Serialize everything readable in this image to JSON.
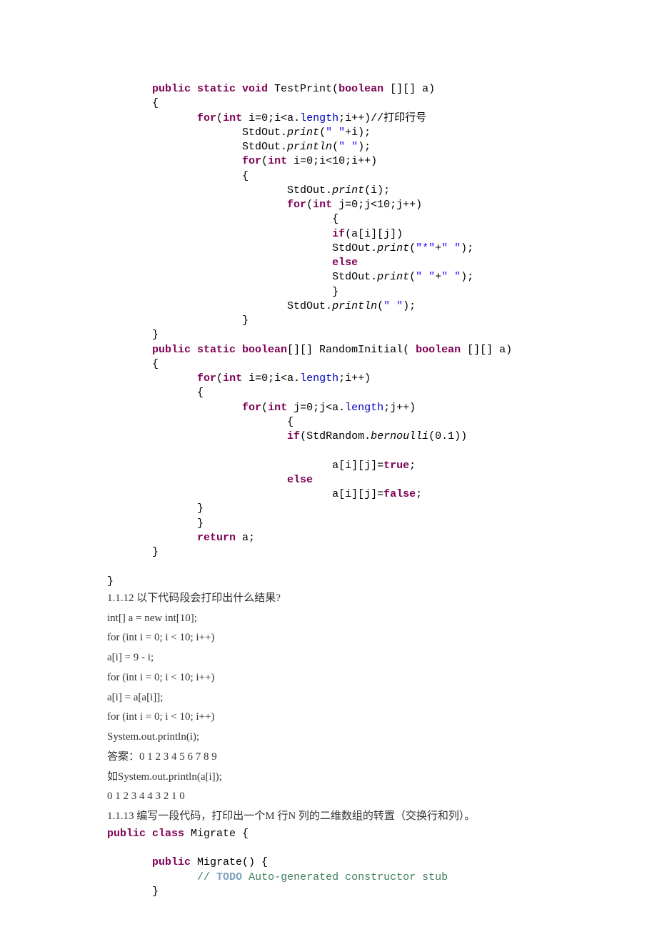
{
  "code1": {
    "l1a": "public static void",
    "l1b": " TestPrint(",
    "l1c": "boolean",
    "l1d": " [][] a)",
    "l2": "{",
    "l3a": "for",
    "l3b": "(",
    "l3c": "int",
    "l3d": " i=0;i<a.",
    "l3e": "length",
    "l3f": ";i++)//打印行号",
    "l4a": "StdOut.",
    "l4b": "print",
    "l4c": "(",
    "l4d": "\" \"",
    "l4e": "+i);",
    "l5a": "StdOut.",
    "l5b": "println",
    "l5c": "(",
    "l5d": "\" \"",
    "l5e": ");",
    "l6a": "for",
    "l6b": "(",
    "l6c": "int",
    "l6d": " i=0;i<10;i++)",
    "l7": "{",
    "l8a": "StdOut.",
    "l8b": "print",
    "l8c": "(i);",
    "l9a": "for",
    "l9b": "(",
    "l9c": "int",
    "l9d": " j=0;j<10;j++)",
    "l10": "{",
    "l11a": "if",
    "l11b": "(a[i][j])",
    "l12a": "StdOut.",
    "l12b": "print",
    "l12c": "(",
    "l12d": "\"*\"",
    "l12e": "+",
    "l12f": "\" \"",
    "l12g": ");",
    "l13": "else",
    "l14a": "StdOut.",
    "l14b": "print",
    "l14c": "(",
    "l14d": "\" \"",
    "l14e": "+",
    "l14f": "\" \"",
    "l14g": ");",
    "l15": "}",
    "l16a": "StdOut.",
    "l16b": "println",
    "l16c": "(",
    "l16d": "\" \"",
    "l16e": ");",
    "l17": "}",
    "l18": "}",
    "l19a": "public static boolean",
    "l19b": "[][] RandomInitial( ",
    "l19c": "boolean",
    "l19d": " [][] a)",
    "l20": "{",
    "l21a": "for",
    "l21b": "(",
    "l21c": "int",
    "l21d": " i=0;i<a.",
    "l21e": "length",
    "l21f": ";i++)",
    "l22": "{",
    "l23a": "for",
    "l23b": "(",
    "l23c": "int",
    "l23d": " j=0;j<a.",
    "l23e": "length",
    "l23f": ";j++)",
    "l24": "{",
    "l25a": "if",
    "l25b": "(StdRandom.",
    "l25c": "bernoulli",
    "l25d": "(0.1))",
    "blank": "",
    "l26a": "a[i][j]=",
    "l26b": "true",
    "l26c": ";",
    "l27": "else",
    "l28a": "a[i][j]=",
    "l28b": "false",
    "l28c": ";",
    "l29": "}",
    "l30": "}",
    "l31a": "return",
    "l31b": " a;",
    "l32": "}",
    "l33": "}"
  },
  "prose": {
    "p1": "1.1.12 以下代码段会打印出什么结果?",
    "p2": "int[] a = new int[10];",
    "p3": "for (int i = 0; i < 10; i++)",
    "p4": "a[i] = 9 - i;",
    "p5": "for (int i = 0; i < 10; i++)",
    "p6": "a[i] = a[a[i]];",
    "p7": "for (int i = 0; i < 10; i++)",
    "p8": "System.out.println(i);",
    "p9": "答案：0 1 2 3 4 5 6 7 8 9",
    "p10": "如System.out.println(a[i]);",
    "p11": "0 1 2 3 4 4 3 2 1 0",
    "p12": "1.1.13 编写一段代码，打印出一个M 行N 列的二维数组的转置（交换行和列）。"
  },
  "code2": {
    "m1a": "public class",
    "m1b": " Migrate {",
    "m2a": "public",
    "m2b": " Migrate() {",
    "m3a": "// ",
    "m3b": "TODO",
    "m3c": " Auto-generated constructor stub",
    "m4": "}"
  }
}
